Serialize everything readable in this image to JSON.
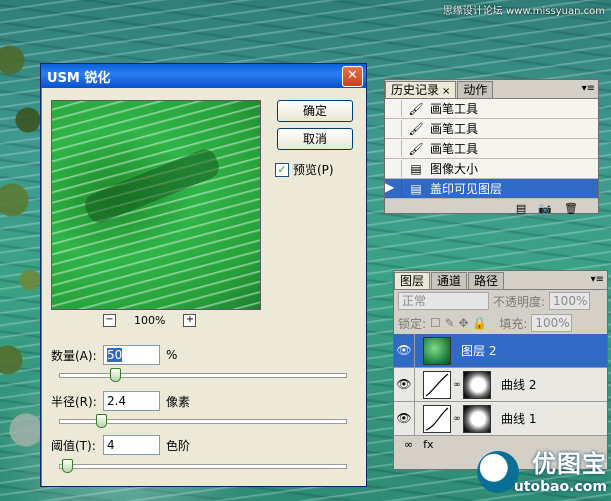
{
  "watermark_top": "思缘设计论坛 www.missyuan.com",
  "dialog": {
    "title": "USM 锐化",
    "close_label": "✕",
    "ok_label": "确定",
    "cancel_label": "取消",
    "preview_label": "预览(P)",
    "preview_checked": true,
    "zoom_out": "−",
    "zoom_in": "+",
    "zoom_value": "100%",
    "amount": {
      "label": "数量(A):",
      "value": "50",
      "unit": "%",
      "level": 0.19
    },
    "radius": {
      "label": "半径(R):",
      "value": "2.4",
      "unit": "像素",
      "level": 0.14
    },
    "threshold": {
      "label": "阈值(T):",
      "value": "4",
      "unit": "色阶",
      "level": 0.02
    }
  },
  "history_panel": {
    "tabs": [
      {
        "label": "历史记录",
        "close": "×"
      },
      {
        "label": "动作"
      }
    ],
    "menu": "▾≡",
    "items": [
      {
        "label": "画笔工具",
        "icon": "brush-icon"
      },
      {
        "label": "画笔工具",
        "icon": "brush-icon"
      },
      {
        "label": "画笔工具",
        "icon": "brush-icon"
      },
      {
        "label": "图像大小",
        "icon": "document-icon"
      },
      {
        "label": "盖印可见图层",
        "icon": "document-icon",
        "active": true
      }
    ],
    "footer": [
      "▤",
      "📷",
      "🗑"
    ]
  },
  "layers_panel": {
    "tabs": [
      "图层",
      "通道",
      "路径"
    ],
    "blend_mode": "正常",
    "opacity_label": "不透明度:",
    "opacity_value": "100%",
    "lock_label": "锁定:",
    "fill_label": "填充:",
    "fill_value": "100%",
    "layers": [
      {
        "name": "图层 2",
        "active": true
      },
      {
        "name": "曲线 2"
      },
      {
        "name": "曲线 1"
      }
    ],
    "bottom_fx": "fx"
  },
  "brand": {
    "name": "优图宝",
    "url": "utobao.com"
  },
  "colors": {
    "accent": "#316ac5",
    "titlebar": "#0a5fd8",
    "close": "#c8431f"
  }
}
